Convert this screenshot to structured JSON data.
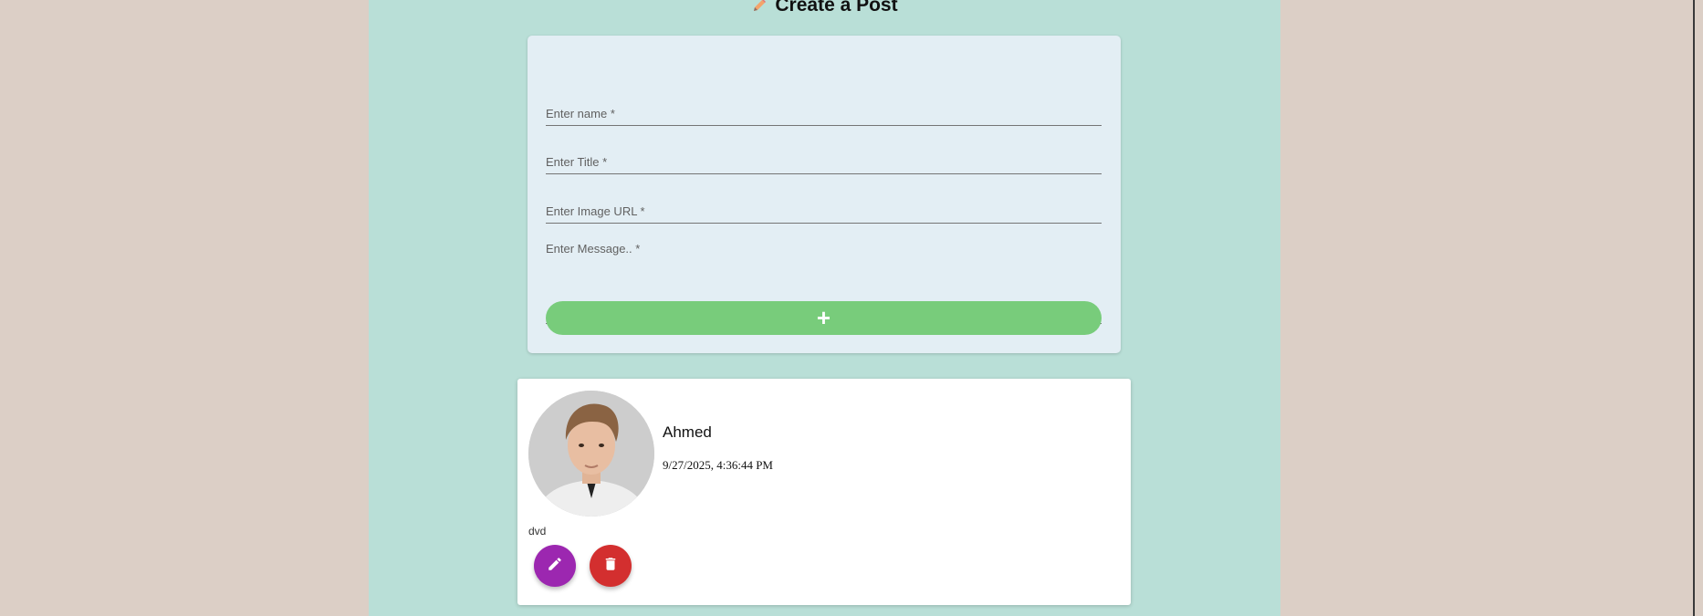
{
  "header": {
    "title": "Create a Post",
    "icon": "pencil-icon"
  },
  "form": {
    "fields": [
      {
        "label": "Enter name *"
      },
      {
        "label": "Enter Title *"
      },
      {
        "label": "Enter Image URL *"
      },
      {
        "label": "Enter Message.. *"
      }
    ],
    "submit_label": "+"
  },
  "post": {
    "author": "Ahmed",
    "date": "9/27/2025, 4:36:44 PM",
    "message": "dvd",
    "edit_icon": "pencil-icon",
    "delete_icon": "trash-icon"
  },
  "colors": {
    "page_background": "#dccfc6",
    "column_background": "#b9dfd7",
    "form_background": "#e3eef4",
    "submit_button": "#78cc7b",
    "edit_button": "#9c27b0",
    "delete_button": "#d32f2f"
  }
}
